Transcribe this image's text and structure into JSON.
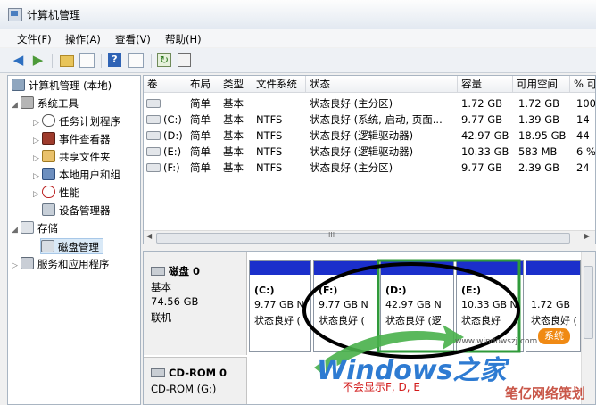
{
  "window": {
    "title": "计算机管理"
  },
  "menu": [
    "文件(F)",
    "操作(A)",
    "查看(V)",
    "帮助(H)"
  ],
  "toolbar": {
    "help_glyph": "?"
  },
  "tree": [
    {
      "label": "计算机管理 (本地)",
      "icon": "computer-icon"
    },
    {
      "label": "系统工具",
      "icon": "tools-icon"
    },
    {
      "label": "任务计划程序",
      "icon": "clock-icon"
    },
    {
      "label": "事件查看器",
      "icon": "event-viewer-icon"
    },
    {
      "label": "共享文件夹",
      "icon": "shared-folder-icon"
    },
    {
      "label": "本地用户和组",
      "icon": "users-icon"
    },
    {
      "label": "性能",
      "icon": "performance-icon"
    },
    {
      "label": "设备管理器",
      "icon": "device-manager-icon"
    },
    {
      "label": "存储",
      "icon": "storage-icon"
    },
    {
      "label": "磁盘管理",
      "icon": "disk-icon"
    },
    {
      "label": "服务和应用程序",
      "icon": "services-icon"
    }
  ],
  "volumes": {
    "columns": [
      "卷",
      "布局",
      "类型",
      "文件系统",
      "状态",
      "容量",
      "可用空间",
      "% 可"
    ],
    "rows": [
      [
        "",
        "简单",
        "基本",
        "",
        "状态良好 (主分区)",
        "1.72 GB",
        "1.72 GB",
        "100"
      ],
      [
        "(C:)",
        "简单",
        "基本",
        "NTFS",
        "状态良好 (系统, 启动, 页面...",
        "9.77 GB",
        "1.39 GB",
        "14"
      ],
      [
        "(D:)",
        "简单",
        "基本",
        "NTFS",
        "状态良好 (逻辑驱动器)",
        "42.97 GB",
        "18.95 GB",
        "44"
      ],
      [
        "(E:)",
        "简单",
        "基本",
        "NTFS",
        "状态良好 (逻辑驱动器)",
        "10.33 GB",
        "583 MB",
        "6 %"
      ],
      [
        "(F:)",
        "简单",
        "基本",
        "NTFS",
        "状态良好 (主分区)",
        "9.77 GB",
        "2.39 GB",
        "24"
      ]
    ]
  },
  "disks": [
    {
      "name": "磁盘 0",
      "type": "基本",
      "size": "74.56 GB",
      "status": "联机"
    },
    {
      "name": "CD-ROM 0",
      "type": "CD-ROM (G:)"
    }
  ],
  "partitions": [
    {
      "label": "(C:)",
      "size": "9.77 GB N",
      "status": "状态良好 ("
    },
    {
      "label": "(F:)",
      "size": "9.77 GB N",
      "status": "状态良好 ("
    },
    {
      "label": "(D:)",
      "size": "42.97 GB N",
      "status": "状态良好 (逻"
    },
    {
      "label": "(E:)",
      "size": "10.33 GB N",
      "status": "状态良好"
    },
    {
      "label": "",
      "size": "1.72 GB",
      "status": "状态良好 ("
    }
  ],
  "scrollbar": {
    "grip": "III"
  },
  "annotations": {
    "watermark": "Windows之家",
    "watermark_url": "www.windowszj.com",
    "badge": "系统",
    "note": "不会显示F, D, E",
    "watermark2": "笔亿网络策划"
  },
  "colors": {
    "partition_bar": "#1b2fcb",
    "highlight_green": "#2f9a3a",
    "ellipse": "#000000",
    "note_red": "#d21a1a"
  }
}
